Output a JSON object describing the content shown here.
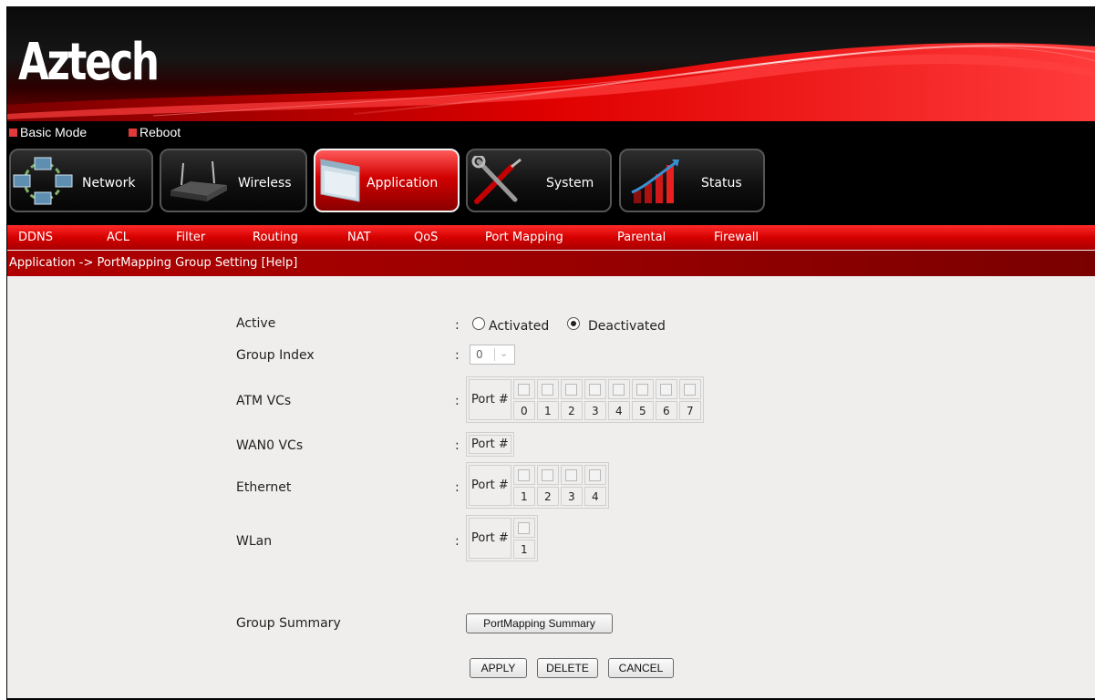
{
  "brand": {
    "logo_text": "Aztech"
  },
  "toplinks": [
    {
      "label": "Basic Mode"
    },
    {
      "label": "Reboot"
    }
  ],
  "main_nav": [
    {
      "label": "Network",
      "icon": "network-icon",
      "active": false
    },
    {
      "label": "Wireless",
      "icon": "router-icon",
      "active": false
    },
    {
      "label": "Application",
      "icon": "application-window-icon",
      "active": true
    },
    {
      "label": "System",
      "icon": "tools-icon",
      "active": false
    },
    {
      "label": "Status",
      "icon": "bar-chart-icon",
      "active": false
    }
  ],
  "sub_nav": [
    {
      "label": "DDNS"
    },
    {
      "label": "ACL"
    },
    {
      "label": "Filter"
    },
    {
      "label": "Routing"
    },
    {
      "label": "NAT"
    },
    {
      "label": "QoS"
    },
    {
      "label": "Port Mapping"
    },
    {
      "label": "Parental"
    },
    {
      "label": "Firewall"
    }
  ],
  "breadcrumb": "Application -> PortMapping Group Setting [Help]",
  "form": {
    "colon": ":",
    "active": {
      "label": "Active",
      "options": [
        "Activated",
        "Deactivated"
      ],
      "selected": "Deactivated"
    },
    "group_index": {
      "label": "Group Index",
      "value": "0"
    },
    "port_label": "Port #",
    "atm_vcs": {
      "label": "ATM VCs",
      "ports": [
        "0",
        "1",
        "2",
        "3",
        "4",
        "5",
        "6",
        "7"
      ]
    },
    "wan0_vcs": {
      "label": "WAN0 VCs",
      "ports": []
    },
    "ethernet": {
      "label": "Ethernet",
      "ports": [
        "1",
        "2",
        "3",
        "4"
      ]
    },
    "wlan": {
      "label": "WLan",
      "ports": [
        "1"
      ]
    },
    "group_summary": {
      "label": "Group Summary",
      "button": "PortMapping Summary"
    }
  },
  "actions": {
    "apply": "APPLY",
    "delete": "DELETE",
    "cancel": "CANCEL"
  },
  "colors": {
    "accent_red": "#d40000",
    "active_nav_red": "#e00000",
    "page_bg": "#efeeed",
    "header_bg": "#000000"
  }
}
